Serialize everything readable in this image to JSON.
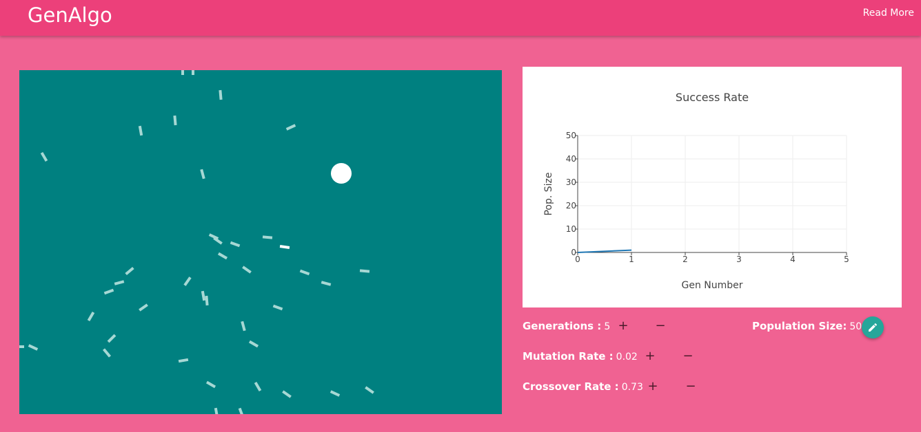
{
  "header": {
    "brand": "GenAlgo",
    "read_more": "Read More"
  },
  "simulation": {
    "bg_color": "#008080",
    "target_color": "#ffffff",
    "agent_color": "#a6d8d4"
  },
  "chart_data": {
    "type": "line",
    "title": "Success Rate",
    "xlabel": "Gen Number",
    "ylabel": "Pop. Size",
    "xlim": [
      0,
      5
    ],
    "ylim": [
      0,
      50
    ],
    "x_ticks": [
      0,
      1,
      2,
      3,
      4,
      5
    ],
    "y_ticks": [
      0,
      10,
      20,
      30,
      40,
      50
    ],
    "grid": true,
    "series": [
      {
        "x": [
          0,
          1
        ],
        "y": [
          0,
          1
        ],
        "color": "#1f77b4"
      }
    ]
  },
  "controls": {
    "generations": {
      "label": "Generations :",
      "value": "5"
    },
    "mutation_rate": {
      "label": "Mutation Rate :",
      "value": "0.02"
    },
    "crossover_rate": {
      "label": "Crossover Rate :",
      "value": "0.73"
    },
    "population_size": {
      "label": "Population Size:",
      "value": "50"
    },
    "plus": "+",
    "minus": "−"
  }
}
